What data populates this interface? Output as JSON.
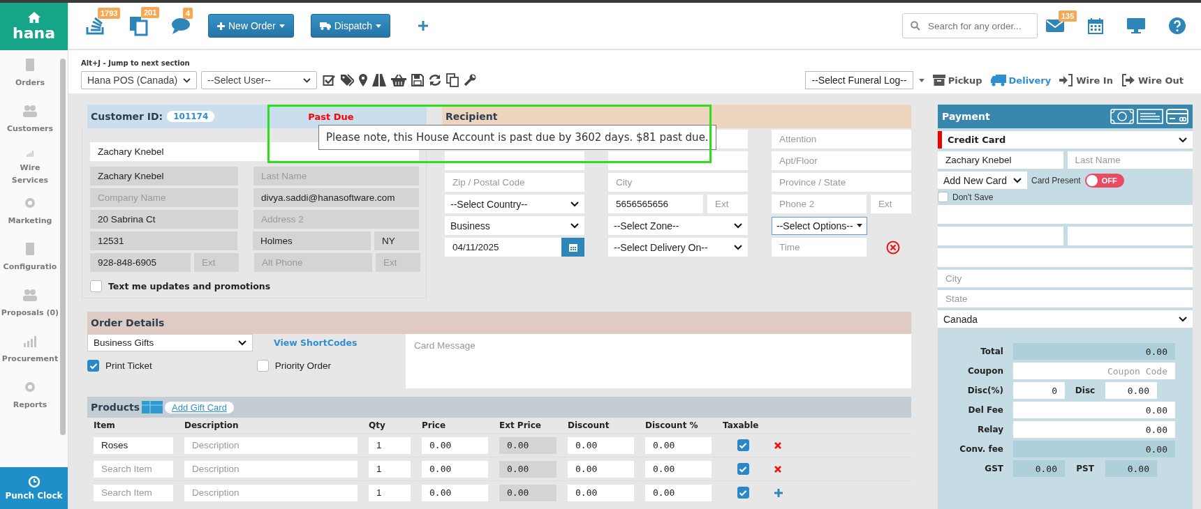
{
  "sidebar": {
    "logo": "hana",
    "items": [
      {
        "label": "Orders"
      },
      {
        "label": "Customers"
      },
      {
        "label": "Wire Services"
      },
      {
        "label": "Marketing"
      },
      {
        "label": "Configuratio"
      },
      {
        "label": "Proposals (0)"
      },
      {
        "label": "Procurement"
      },
      {
        "label": "Reports"
      }
    ],
    "punch_clock": "Punch Clock"
  },
  "topbar": {
    "counters": [
      {
        "count": "1793"
      },
      {
        "count": "201"
      },
      {
        "count": "4"
      }
    ],
    "buttons": [
      "New Order",
      "Dispatch"
    ],
    "search": {
      "placeholder": "Search for any order..."
    },
    "mail_count": "135"
  },
  "toolbar": {
    "hint": "Alt+J - Jump to next section",
    "store": "Hana POS (Canada)",
    "user": "--Select User--",
    "funeral": "--Select Funeral Log--",
    "modes": [
      {
        "label": "Pickup",
        "selected": false
      },
      {
        "label": "Delivery",
        "selected": true
      },
      {
        "label": "Wire In",
        "selected": false
      },
      {
        "label": "Wire Out",
        "selected": false
      }
    ]
  },
  "customer": {
    "label": "Customer ID:",
    "id": "101174",
    "status": "Past Due",
    "search_value": "Zachary Knebel",
    "rows": [
      {
        "left": [
          {
            "value": "Zachary Knebel"
          }
        ],
        "right": [
          {
            "placeholder": "Last Name"
          }
        ]
      },
      {
        "left": [
          {
            "placeholder": "Company Name"
          }
        ],
        "right": [
          {
            "value": "divya.saddi@hanasoftware.com"
          }
        ]
      },
      {
        "left": [
          {
            "value": "20 Sabrina Ct"
          }
        ],
        "right": [
          {
            "placeholder": "Address 2"
          }
        ]
      },
      {
        "left": [
          {
            "value": "12531"
          }
        ],
        "right": [
          {
            "value": "Holmes"
          },
          {
            "value": "NY"
          }
        ]
      },
      {
        "left": [
          {
            "value": "928-848-6905"
          },
          {
            "placeholder": "Ext"
          }
        ],
        "right": [
          {
            "placeholder": "Alt Phone"
          },
          {
            "placeholder": "Ext"
          }
        ]
      }
    ],
    "text_updates": {
      "label": "Text me updates and promotions",
      "checked": false
    }
  },
  "tooltip": "Please note, this House Account is past due by 3602 days. $81 past due.",
  "recipient": {
    "title": "Recipient",
    "rows": [
      [
        {
          "kind": "input"
        },
        {
          "kind": "input"
        },
        {
          "kind": "input",
          "placeholder": "Attention"
        }
      ],
      [
        {
          "kind": "input"
        },
        {
          "kind": "input"
        },
        {
          "kind": "input",
          "placeholder": "Apt/Floor"
        }
      ],
      [
        {
          "kind": "input",
          "placeholder": "Zip / Postal Code"
        },
        {
          "kind": "input",
          "placeholder": "City"
        },
        {
          "kind": "input",
          "placeholder": "Province / State"
        }
      ],
      [
        {
          "kind": "select",
          "value": "--Select Country--"
        },
        {
          "kind": "pair",
          "first": {
            "value": "5656565656"
          },
          "second": {
            "placeholder": "Ext"
          }
        },
        {
          "kind": "pair",
          "first": {
            "placeholder": "Phone 2"
          },
          "second": {
            "placeholder": "Ext"
          }
        }
      ],
      [
        {
          "kind": "select",
          "value": "Business"
        },
        {
          "kind": "select",
          "value": "--Select Zone--"
        },
        {
          "kind": "options",
          "value": "--Select Options--"
        }
      ],
      [
        {
          "kind": "date",
          "value": "04/11/2025"
        },
        {
          "kind": "select",
          "value": "--Select Delivery On--"
        },
        {
          "kind": "time",
          "placeholder": "Time"
        }
      ]
    ]
  },
  "order": {
    "title": "Order Details",
    "occasion": "Business Gifts",
    "shortcodes": "View ShortCodes",
    "card_placeholder": "Card Message",
    "checks": [
      {
        "label": "Print Ticket",
        "checked": true
      },
      {
        "label": "Priority Order",
        "checked": false
      }
    ]
  },
  "products": {
    "title": "Products",
    "gift_card": "Add Gift Card",
    "columns": [
      "Item",
      "Description",
      "Qty",
      "Price",
      "Ext Price",
      "Discount",
      "Discount %",
      "Taxable"
    ],
    "rows": [
      {
        "item": {
          "value": "Roses"
        },
        "description": {
          "placeholder": "Description"
        },
        "qty": "1",
        "price": "0.00",
        "ext_price": "0.00",
        "discount": "0.00",
        "discount_pct": "0.00",
        "taxable": true,
        "kind": "removable"
      },
      {
        "item": {
          "placeholder": "Search Item"
        },
        "description": {
          "placeholder": "Description"
        },
        "qty": "1",
        "price": "0.00",
        "ext_price": "0.00",
        "discount": "0.00",
        "discount_pct": "0.00",
        "taxable": true,
        "kind": "removable"
      },
      {
        "item": {
          "placeholder": "Search Item"
        },
        "description": {
          "placeholder": "Description"
        },
        "qty": "1",
        "price": "0.00",
        "ext_price": "0.00",
        "discount": "0.00",
        "discount_pct": "0.00",
        "taxable": true,
        "kind": "addable"
      }
    ]
  },
  "payment": {
    "title": "Payment",
    "method": "Credit Card",
    "first_name": "Zachary Knebel",
    "last_name_placeholder": "Last Name",
    "card_select": "Add New Card",
    "card_present": {
      "label": "Card Present",
      "on": false,
      "state_label": "OFF"
    },
    "dont_save": {
      "label": "Don't Save",
      "checked": false
    },
    "city_placeholder": "City",
    "state_placeholder": "State",
    "country": "Canada",
    "totals": [
      {
        "kind": "single",
        "label": "Total",
        "value": "0.00",
        "readonly": true
      },
      {
        "kind": "single",
        "label": "Coupon",
        "placeholder": "Coupon Code",
        "readonly": false
      },
      {
        "kind": "pair",
        "label": "Disc(%)",
        "value": "0",
        "label2": "Disc",
        "value2": "0.00",
        "readonly": false
      },
      {
        "kind": "single",
        "label": "Del Fee",
        "value": "0.00",
        "readonly": false
      },
      {
        "kind": "single",
        "label": "Relay",
        "value": "0.00",
        "readonly": false
      },
      {
        "kind": "single",
        "label": "Conv. fee",
        "value": "0.00",
        "readonly": true
      },
      {
        "kind": "pair",
        "label": "GST",
        "value": "0.00",
        "label2": "PST",
        "value2": "0.00",
        "readonly": true
      }
    ]
  }
}
